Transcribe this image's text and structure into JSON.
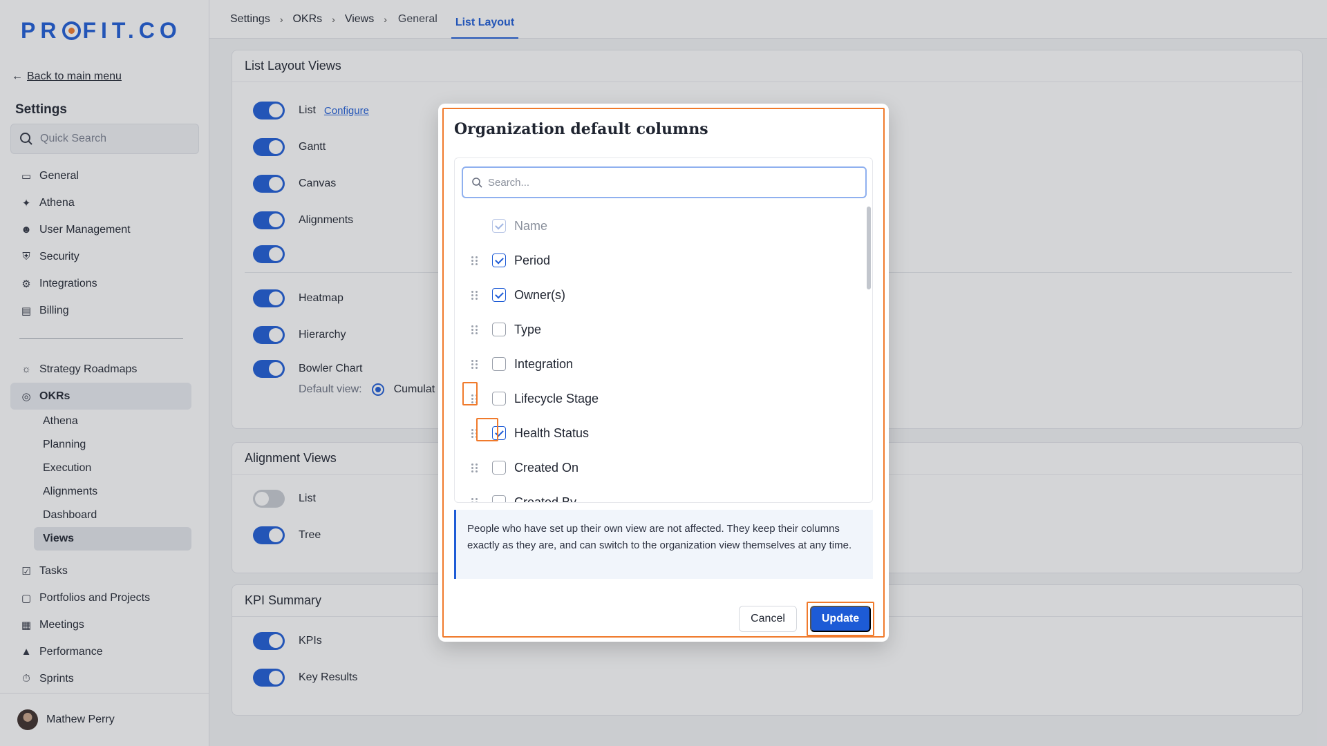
{
  "brand": {
    "logo_pre": "PR",
    "logo_post": "FIT.CO"
  },
  "sidebar": {
    "back_label": "Back to main menu",
    "settings_title": "Settings",
    "search_placeholder": "Quick Search",
    "items": [
      {
        "label": "General",
        "icon": "monitor-icon"
      },
      {
        "label": "Athena",
        "icon": "sparkle-icon"
      },
      {
        "label": "User Management",
        "icon": "user-icon"
      },
      {
        "label": "Security",
        "icon": "shield-icon"
      },
      {
        "label": "Integrations",
        "icon": "gear-icon"
      },
      {
        "label": "Billing",
        "icon": "receipt-icon"
      }
    ],
    "items2": [
      {
        "label": "Strategy Roadmaps",
        "icon": "bulb-icon"
      },
      {
        "label": "OKRs",
        "icon": "target-icon"
      }
    ],
    "okr_sub": [
      "Athena",
      "Planning",
      "Execution",
      "Alignments",
      "Dashboard",
      "Views"
    ],
    "items3": [
      {
        "label": "Tasks",
        "icon": "clipboard-icon"
      },
      {
        "label": "Portfolios and Projects",
        "icon": "briefcase-icon"
      },
      {
        "label": "Meetings",
        "icon": "calendar-icon"
      },
      {
        "label": "Performance",
        "icon": "chart-icon"
      },
      {
        "label": "Sprints",
        "icon": "stopwatch-icon"
      }
    ],
    "user_name": "Mathew Perry"
  },
  "breadcrumb": {
    "c1": "Settings",
    "c2": "OKRs",
    "c3": "Views",
    "tab1": "General",
    "tab2": "List Layout"
  },
  "list_layout": {
    "title": "List Layout Views",
    "list": "List",
    "configure": "Configure",
    "gantt": "Gantt",
    "canvas": "Canvas",
    "alignments": "Alignments",
    "heatmap": "Heatmap",
    "hierarchy": "Hierarchy",
    "bowler": "Bowler Chart",
    "default_view_label": "Default view:",
    "default_view_value": "Cumulat"
  },
  "alignment_views": {
    "title": "Alignment Views",
    "list": "List",
    "tree": "Tree"
  },
  "kpi_summary": {
    "title": "KPI Summary",
    "kpis": "KPIs",
    "key_results": "Key Results"
  },
  "modal": {
    "title": "Organization default columns",
    "search_placeholder": "Search...",
    "columns": [
      {
        "label": "Name",
        "checked": true,
        "disabled": true
      },
      {
        "label": "Period",
        "checked": true
      },
      {
        "label": "Owner(s)",
        "checked": true
      },
      {
        "label": "Type",
        "checked": false
      },
      {
        "label": "Integration",
        "checked": false
      },
      {
        "label": "Lifecycle Stage",
        "checked": false
      },
      {
        "label": "Health Status",
        "checked": true
      },
      {
        "label": "Created On",
        "checked": false
      },
      {
        "label": "Created By",
        "checked": false
      }
    ],
    "info": "People who have set up their own view are not affected. They keep their columns exactly as they are, and can switch to the organization view themselves at any time.",
    "cancel": "Cancel",
    "update": "Update"
  },
  "colors": {
    "accent": "#1d5bd6",
    "highlight": "#f07a2b"
  }
}
